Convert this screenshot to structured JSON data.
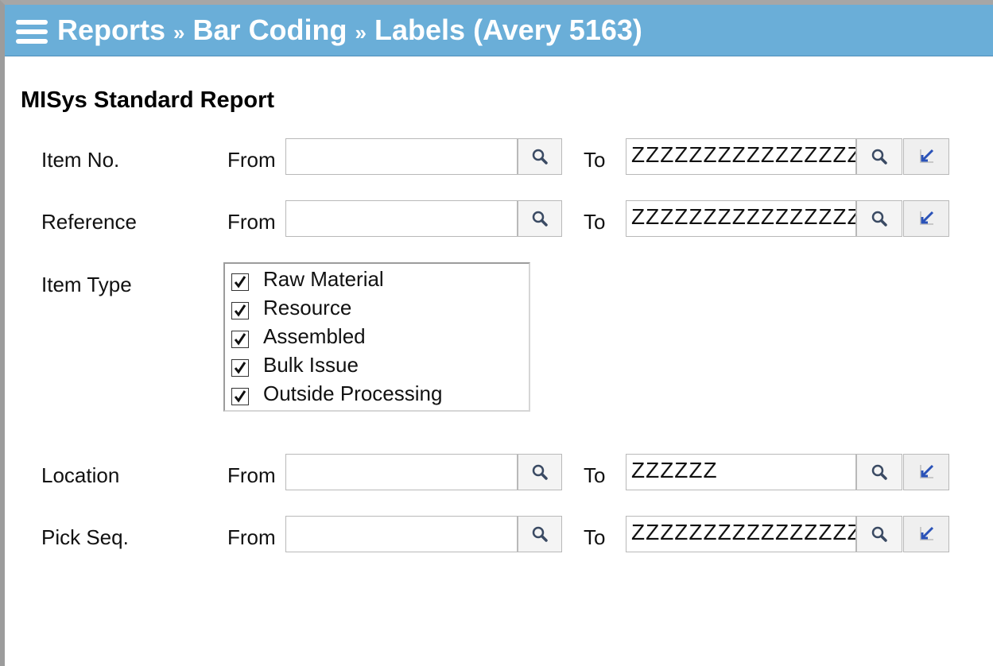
{
  "titlebar": {
    "menu_icon": "hamburger-menu-icon",
    "part1": "Reports",
    "sep1": "»",
    "part2": "Bar Coding",
    "sep2": "»",
    "part3": "Labels (Avery 5163)"
  },
  "report": {
    "heading": "MISys Standard Report"
  },
  "fields": {
    "item_no": {
      "label": "Item No.",
      "from_label": "From",
      "from_value": "",
      "to_label": "To",
      "to_value": "ZZZZZZZZZZZZZZZZZZ"
    },
    "reference": {
      "label": "Reference",
      "from_label": "From",
      "from_value": "",
      "to_label": "To",
      "to_value": "ZZZZZZZZZZZZZZZZZZ"
    },
    "location": {
      "label": "Location",
      "from_label": "From",
      "from_value": "",
      "to_label": "To",
      "to_value": "ZZZZZZ"
    },
    "pick_seq": {
      "label": "Pick Seq.",
      "from_label": "From",
      "from_value": "",
      "to_label": "To",
      "to_value": "ZZZZZZZZZZZZZZZZZZ"
    }
  },
  "item_type": {
    "label": "Item Type",
    "options": [
      {
        "label": "Raw Material",
        "checked": true
      },
      {
        "label": "Resource",
        "checked": true
      },
      {
        "label": "Assembled",
        "checked": true
      },
      {
        "label": "Bulk Issue",
        "checked": true
      },
      {
        "label": "Outside Processing",
        "checked": true
      }
    ]
  },
  "icons": {
    "lookup": "magnifier-icon",
    "clear": "clear-arrow-icon",
    "check": "checkmark-icon"
  },
  "colors": {
    "titlebar": "#6aaed8",
    "title_text": "#ffffff",
    "clear_arrow": "#2a52b8"
  }
}
